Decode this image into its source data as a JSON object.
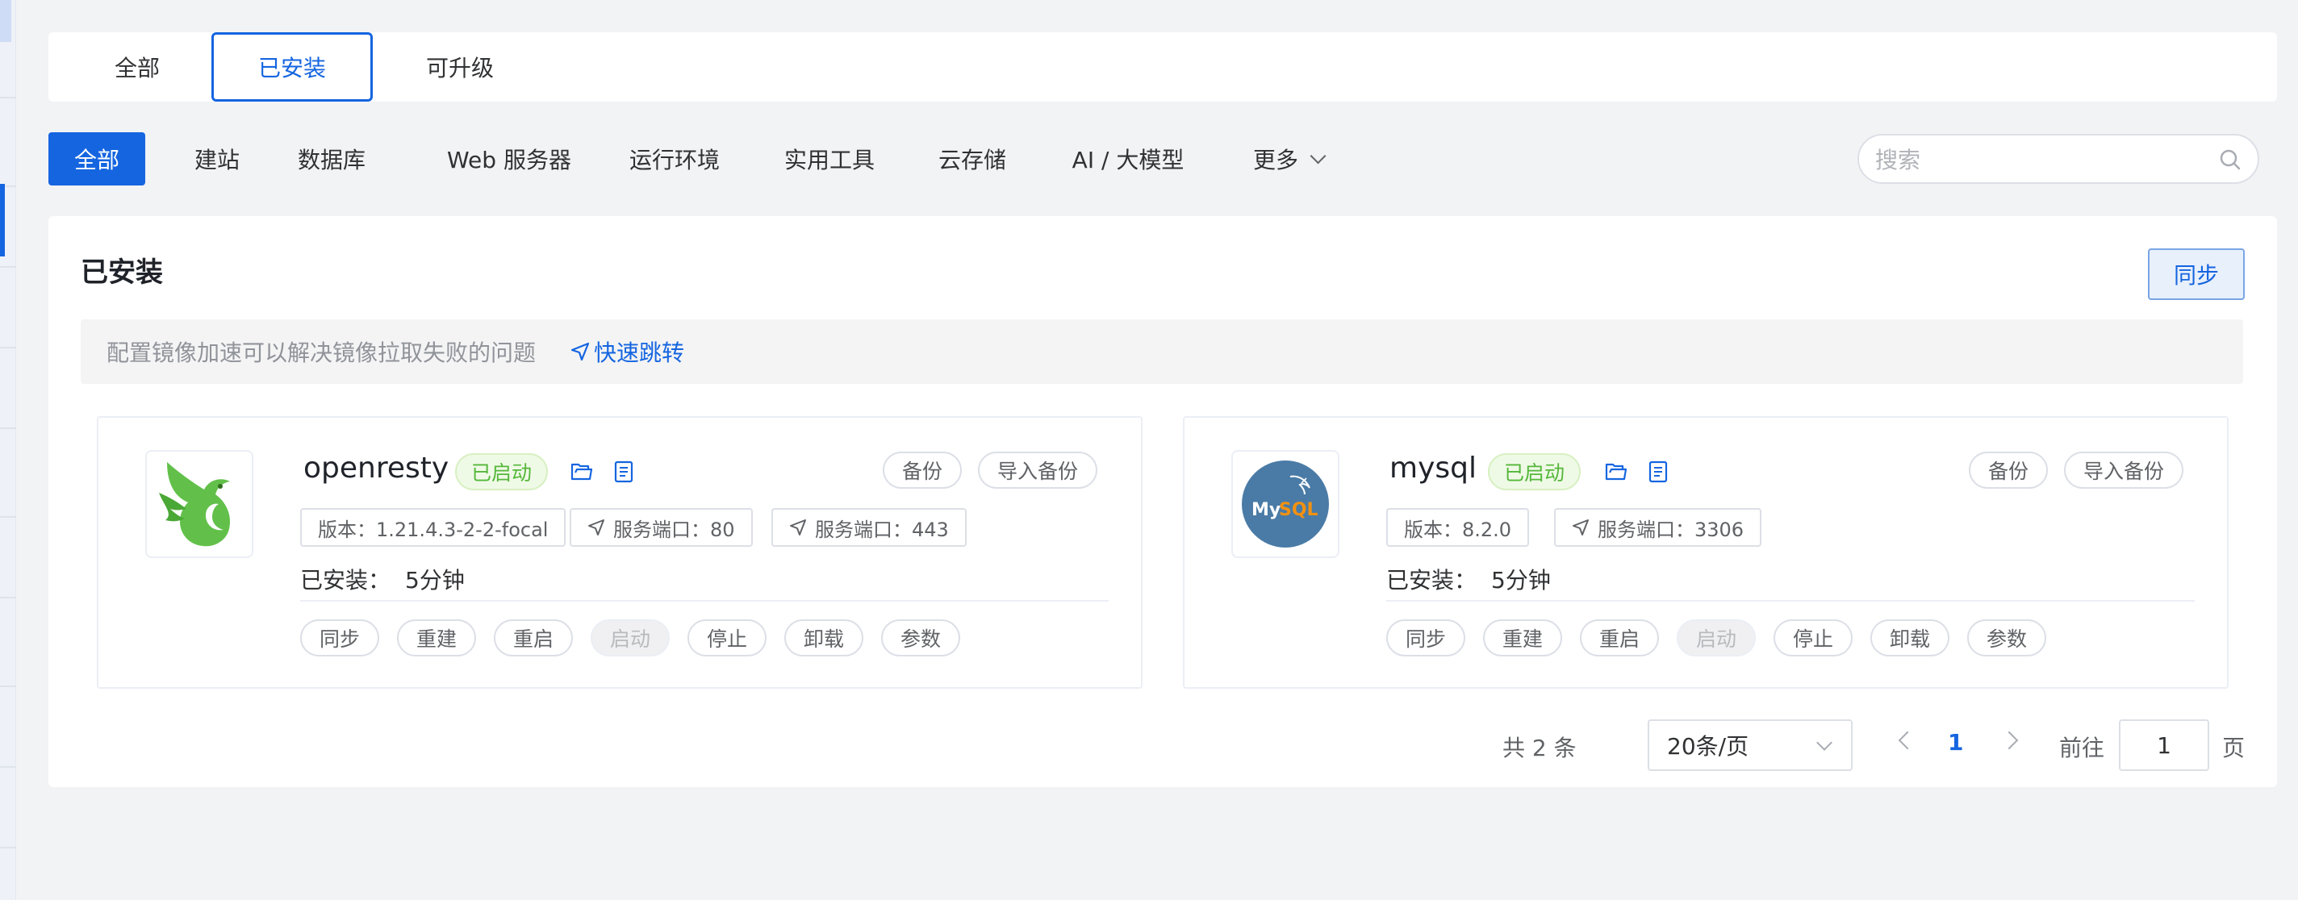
{
  "top_tabs": [
    {
      "label": "全部",
      "active": false
    },
    {
      "label": "已安装",
      "active": true
    },
    {
      "label": "可升级",
      "active": false
    }
  ],
  "categories": [
    {
      "label": "全部",
      "active": true
    },
    {
      "label": "建站"
    },
    {
      "label": "数据库"
    },
    {
      "label": "Web 服务器"
    },
    {
      "label": "运行环境"
    },
    {
      "label": "实用工具"
    },
    {
      "label": "云存储"
    },
    {
      "label": "AI / 大模型"
    },
    {
      "label": "更多"
    }
  ],
  "search": {
    "placeholder": "搜索",
    "icon": "search-icon"
  },
  "section": {
    "title": "已安装",
    "sync_label": "同步",
    "notice_text": "配置镜像加速可以解决镜像拉取失败的问题",
    "notice_link": "快速跳转"
  },
  "apps": [
    {
      "name": "openresty",
      "status": "已启动",
      "backup_label": "备份",
      "import_label": "导入备份",
      "tags": [
        "版本：1.21.4.3-2-2-focal",
        "服务端口：80",
        "服务端口：443"
      ],
      "installed_label": "已安装：",
      "installed_value": "5分钟",
      "actions": [
        "同步",
        "重建",
        "重启",
        "启动",
        "停止",
        "卸载",
        "参数"
      ],
      "disabled_action": "启动"
    },
    {
      "name": "mysql",
      "status": "已启动",
      "backup_label": "备份",
      "import_label": "导入备份",
      "tags": [
        "版本：8.2.0",
        "服务端口：3306"
      ],
      "installed_label": "已安装：",
      "installed_value": "5分钟",
      "actions": [
        "同步",
        "重建",
        "重启",
        "启动",
        "停止",
        "卸载",
        "参数"
      ],
      "disabled_action": "启动",
      "logo_text": "MySQL"
    }
  ],
  "pagination": {
    "total": "共 2 条",
    "page_size": "20条/页",
    "current_page": "1",
    "goto_label": "前往",
    "goto_value": "1",
    "page_unit": "页"
  },
  "colors": {
    "primary": "#1565e0",
    "success": "#55b73b"
  }
}
